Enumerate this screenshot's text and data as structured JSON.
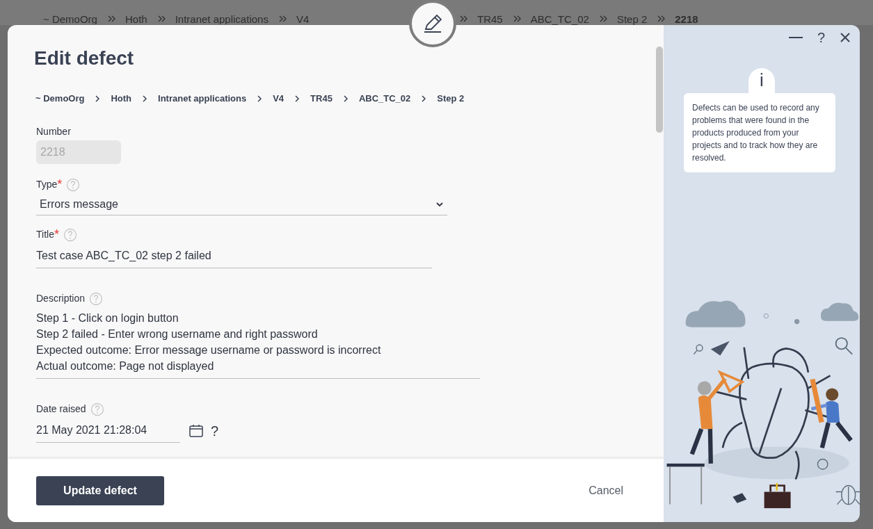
{
  "background_breadcrumb": [
    {
      "text": "~ DemoOrg",
      "current": false
    },
    {
      "text": "Hoth",
      "current": false
    },
    {
      "text": "Intranet applications",
      "current": false
    },
    {
      "text": "V4",
      "current": false
    },
    {
      "text": "TR45",
      "current": false
    },
    {
      "text": "ABC_TC_02",
      "current": false
    },
    {
      "text": "Step 2",
      "current": false
    },
    {
      "text": "2218",
      "current": true
    }
  ],
  "dialog": {
    "title": "Edit defect",
    "breadcrumb": [
      "~ DemoOrg",
      "Hoth",
      "Intranet applications",
      "V4",
      "TR45",
      "ABC_TC_02",
      "Step 2"
    ],
    "fields": [
      {
        "kind": "readonly",
        "label": "Number",
        "help": false,
        "value": "2218"
      },
      {
        "kind": "select",
        "label": "Type",
        "required_mark": "*",
        "help": true,
        "value": "Errors message"
      },
      {
        "kind": "text",
        "label": "Title",
        "required_mark": "*",
        "help": true,
        "value": "Test case ABC_TC_02 step 2 failed"
      },
      {
        "kind": "textarea",
        "label": "Description",
        "help": true,
        "lines": [
          "Step 1 - Click on login button",
          "Step 2 failed - Enter wrong username and right password",
          "Expected outcome: Error message username or password is incorrect",
          "Actual outcome: Page not displayed"
        ]
      },
      {
        "kind": "date",
        "label": "Date raised",
        "help": true,
        "value": "21 May 2021 21:28:04",
        "suffix": "?"
      }
    ],
    "primary_button": "Update defect",
    "cancel_button": "Cancel"
  },
  "help_panel": {
    "help_button": "?",
    "info_mark": "i",
    "text": "Defects can be used to record any problems that were found in the products produced from your projects and to track how they are resolved."
  }
}
